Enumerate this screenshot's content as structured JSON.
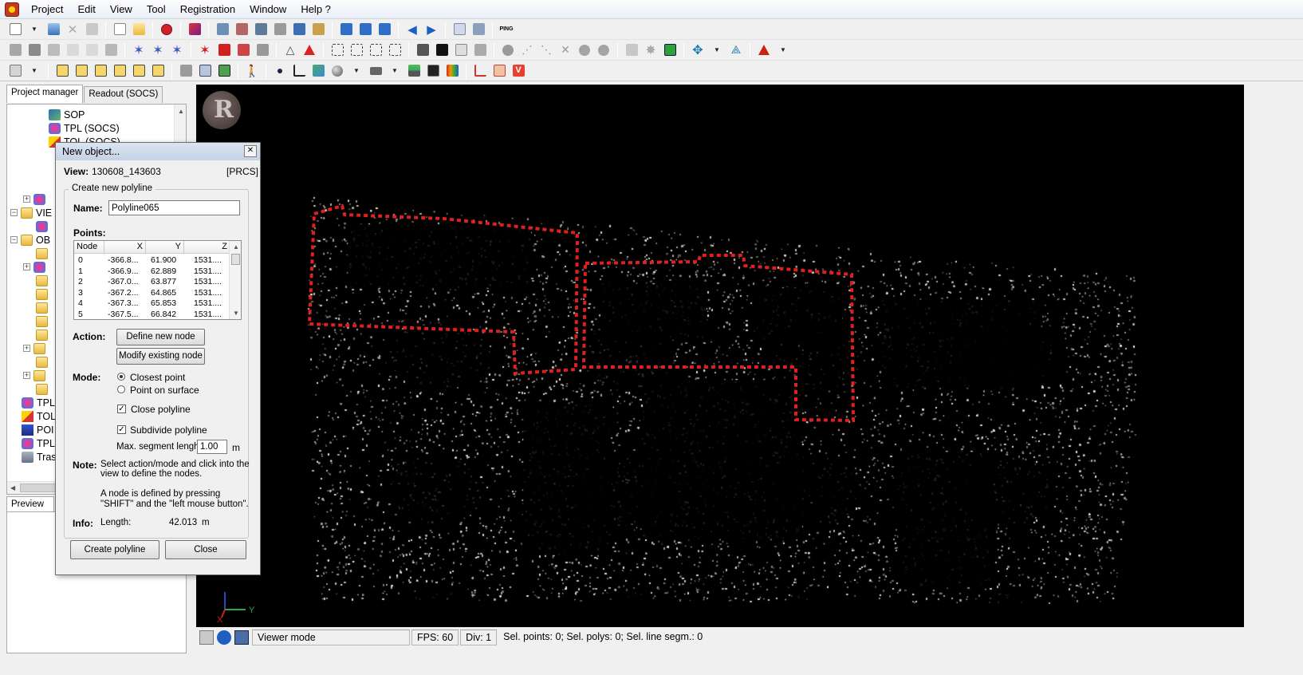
{
  "menu": [
    "Project",
    "Edit",
    "View",
    "Tool",
    "Registration",
    "Window",
    "Help ?"
  ],
  "left_panel": {
    "tabs": [
      "Project manager",
      "Readout (SOCS)"
    ],
    "tree": {
      "sop": "SOP",
      "tpl_socs": "TPL (SOCS)",
      "tol_socs": "TOL (SOCS)",
      "views": "VIE",
      "objects": "OB",
      "tpl": "TPL",
      "tol": "TOL",
      "pol": "POI",
      "tpl2": "TPL",
      "trash": "Tras"
    },
    "preview_tab": "Preview"
  },
  "dialog": {
    "title": "New object...",
    "view_label": "View:",
    "view_value": "130608_143603",
    "frame": "[PRCS]",
    "group_title": "Create new polyline",
    "name_label": "Name:",
    "name_value": "Polyline065",
    "points_label": "Points:",
    "columns": [
      "Node",
      "X",
      "Y",
      "Z"
    ],
    "rows": [
      {
        "node": "0",
        "x": "-366.8...",
        "y": "61.900",
        "z": "1531...."
      },
      {
        "node": "1",
        "x": "-366.9...",
        "y": "62.889",
        "z": "1531...."
      },
      {
        "node": "2",
        "x": "-367.0...",
        "y": "63.877",
        "z": "1531...."
      },
      {
        "node": "3",
        "x": "-367.2...",
        "y": "64.865",
        "z": "1531...."
      },
      {
        "node": "4",
        "x": "-367.3...",
        "y": "65.853",
        "z": "1531...."
      },
      {
        "node": "5",
        "x": "-367.5...",
        "y": "66.842",
        "z": "1531...."
      }
    ],
    "action_label": "Action:",
    "define_node": "Define new node",
    "modify_node": "Modify existing node",
    "mode_label": "Mode:",
    "mode_closest": "Closest point",
    "mode_surface": "Point on surface",
    "mode_selected": "Closest point",
    "close_polyline": "Close polyline",
    "close_polyline_checked": true,
    "subdivide": "Subdivide polyline",
    "subdivide_checked": true,
    "max_segment_label": "Max. segment lenght:",
    "max_segment_value": "1.00",
    "unit": "m",
    "note_label": "Note:",
    "note_text1": "Select action/mode and click into the",
    "note_text2": "view to define the nodes.",
    "note_text3": "A node is defined by pressing",
    "note_text4": "\"SHIFT\" and the \"left mouse button\".",
    "info_label": "Info:",
    "info_text": "Length:",
    "info_value": "42.013",
    "info_unit": "m",
    "create_button": "Create polyline",
    "close_button": "Close"
  },
  "viewer": {
    "axis_y": "Y",
    "axis_x": "X",
    "polyline_color": "#e02020"
  },
  "status": {
    "mode": "Viewer mode",
    "fps": "FPS: 60",
    "div": "Div: 1",
    "selection": "Sel. points: 0;  Sel. polys: 0;  Sel. line segm.: 0"
  }
}
